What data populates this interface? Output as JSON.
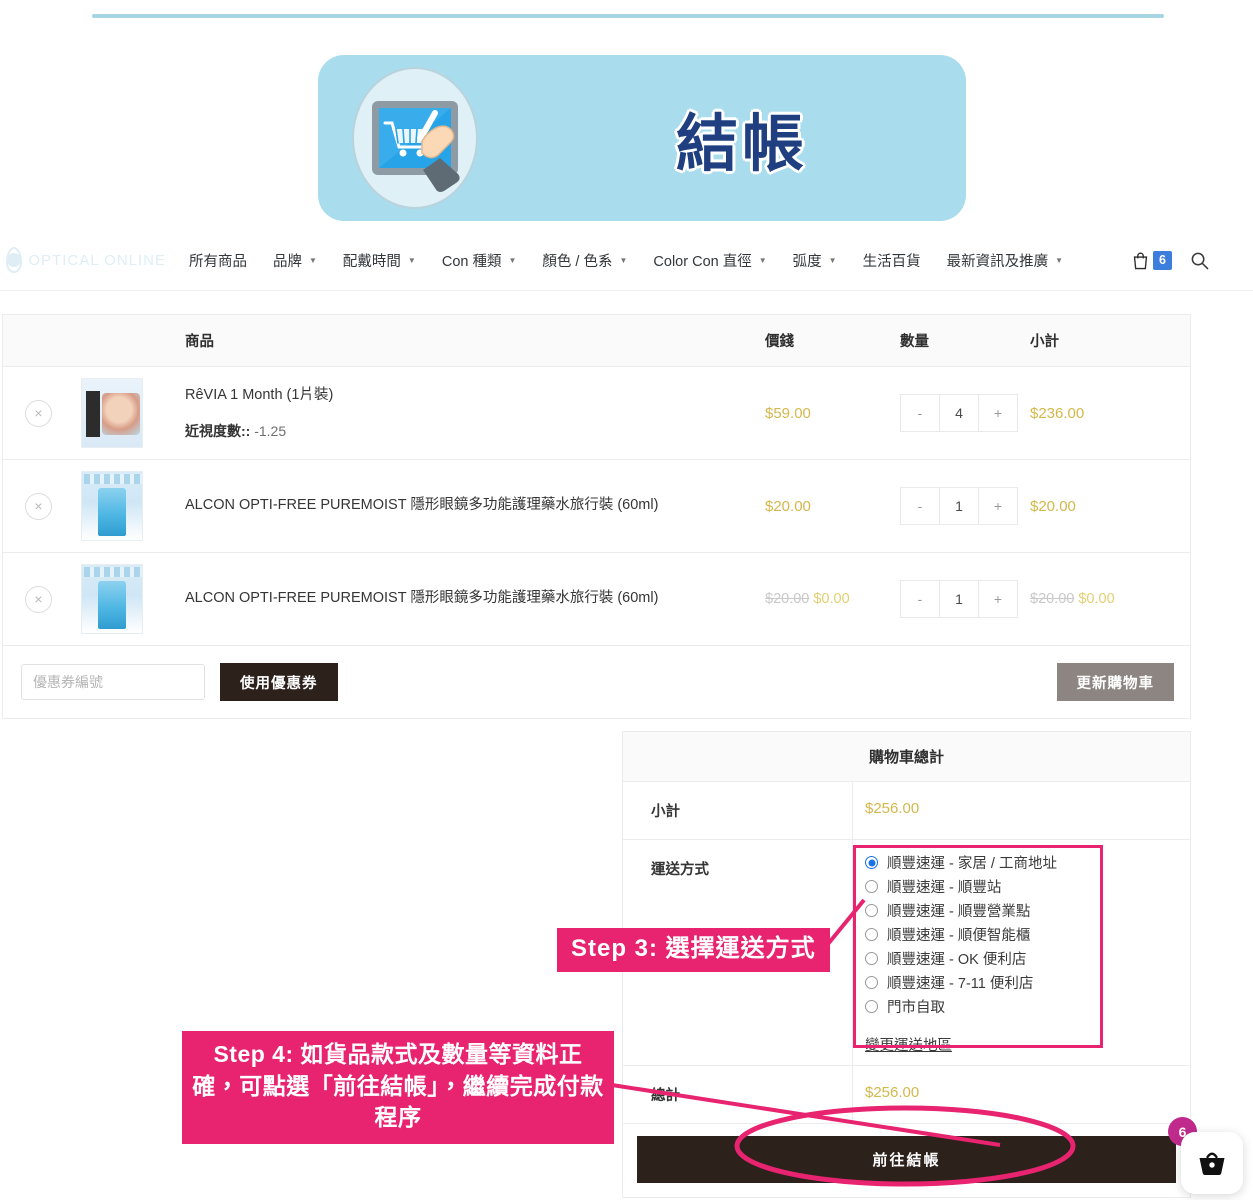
{
  "banner": {
    "title": "結帳",
    "icon": "checkout-tablet-cart-icon"
  },
  "nav": {
    "logo_text": "OPTICAL ONLINE",
    "items": [
      {
        "label": "所有商品",
        "caret": false
      },
      {
        "label": "品牌",
        "caret": true
      },
      {
        "label": "配戴時間",
        "caret": true
      },
      {
        "label": "Con 種類",
        "caret": true
      },
      {
        "label": "顏色 / 色系",
        "caret": true
      },
      {
        "label": "Color Con 直徑",
        "caret": true
      },
      {
        "label": "弧度",
        "caret": true
      },
      {
        "label": "生活百貨",
        "caret": false
      },
      {
        "label": "最新資訊及推廣",
        "caret": true
      }
    ],
    "cart_count": "6",
    "cart_icon": "shopping-bag-icon",
    "search_icon": "search-icon",
    "caret_glyph": "▼"
  },
  "cart_table": {
    "headers": {
      "product": "商品",
      "price": "價錢",
      "quantity": "數量",
      "subtotal": "小計"
    },
    "remove_glyph": "×",
    "rows": [
      {
        "name": "RêVIA 1 Month (1片裝)",
        "meta_label": "近視度數::",
        "meta_value": "-1.25",
        "price": "$59.00",
        "price_old": "",
        "qty": "4",
        "subtotal": "$236.00",
        "subtotal_old": "",
        "minus": "-",
        "plus": "+"
      },
      {
        "name": "ALCON OPTI-FREE PUREMOIST 隱形眼鏡多功能護理藥水旅行裝 (60ml)",
        "meta_label": "",
        "meta_value": "",
        "price": "$20.00",
        "price_old": "",
        "qty": "1",
        "subtotal": "$20.00",
        "subtotal_old": "",
        "minus": "-",
        "plus": "+"
      },
      {
        "name": "ALCON OPTI-FREE PUREMOIST 隱形眼鏡多功能護理藥水旅行裝 (60ml)",
        "meta_label": "",
        "meta_value": "",
        "price": "$0.00",
        "price_old": "$20.00",
        "qty": "1",
        "subtotal": "$0.00",
        "subtotal_old": "$20.00",
        "minus": "-",
        "plus": "+"
      }
    ],
    "coupon_placeholder": "優惠券編號",
    "coupon_value": "",
    "coupon_button": "使用優惠券",
    "update_button": "更新購物車"
  },
  "totals": {
    "title": "購物車總計",
    "subtotal_label": "小計",
    "subtotal_value": "$256.00",
    "shipping_label": "運送方式",
    "shipping_options": [
      {
        "label": "順豐速運 - 家居 / 工商地址",
        "selected": true
      },
      {
        "label": "順豐速運 - 順豐站",
        "selected": false
      },
      {
        "label": "順豐速運 - 順豐營業點",
        "selected": false
      },
      {
        "label": "順豐速運 - 順便智能櫃",
        "selected": false
      },
      {
        "label": "順豐速運 - OK 便利店",
        "selected": false
      },
      {
        "label": "順豐速運 - 7-11 便利店",
        "selected": false
      },
      {
        "label": "門市自取",
        "selected": false
      }
    ],
    "change_area_link": "變更運送地區",
    "total_label": "總計",
    "total_value": "$256.00",
    "checkout_button": "前往結帳"
  },
  "annotations": {
    "step3": "Step 3: 選擇運送方式",
    "step4": "Step 4: 如貨品款式及數量等資料正確，可點選「前往結帳」，繼續完成付款程序",
    "accent_color": "#e8236f"
  },
  "float_cart": {
    "badge": "6",
    "icon": "shopping-basket-icon"
  },
  "colors": {
    "banner_bg": "#a9dced",
    "banner_title": "#1f3f80",
    "price_gold": "#d3b84c",
    "button_dark": "#2d211c",
    "button_gray": "#8d8581",
    "annotation_pink": "#e8236f",
    "nav_badge_blue": "#3d7ddb",
    "float_badge": "#bf2a8c"
  }
}
